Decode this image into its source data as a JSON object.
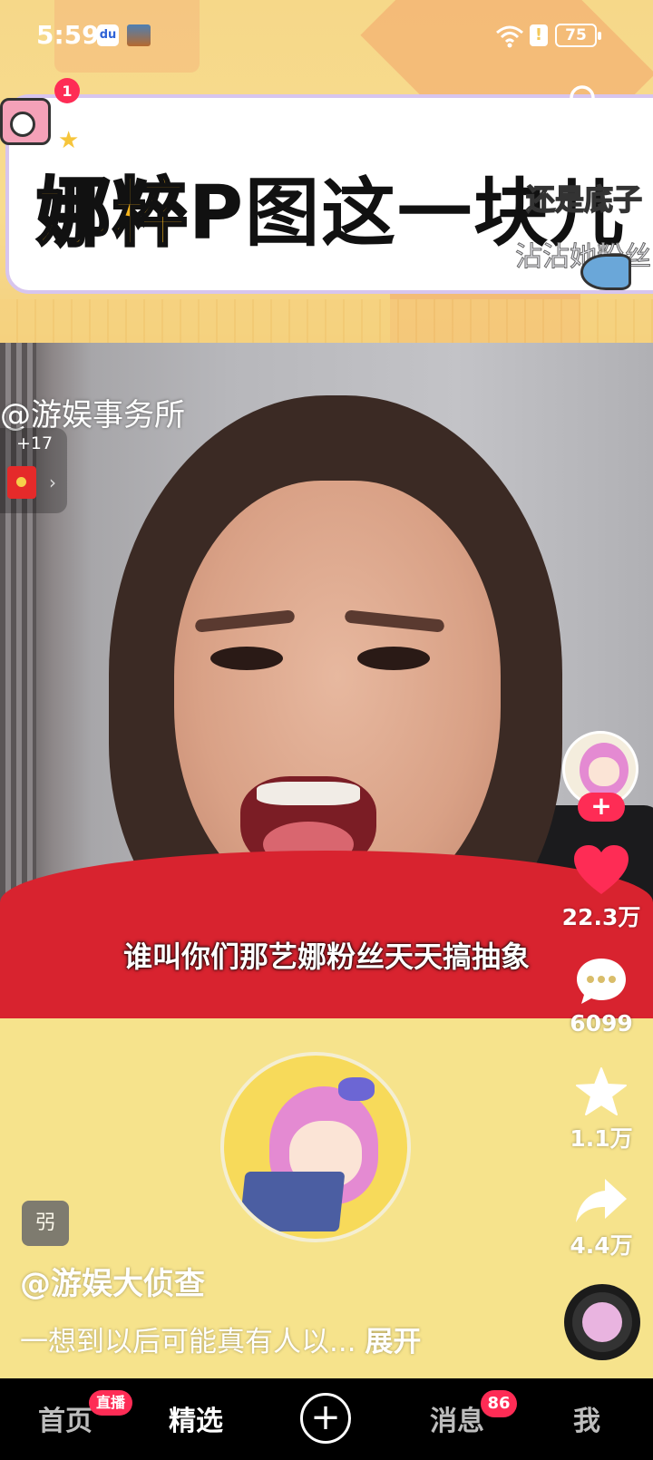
{
  "status_bar": {
    "time": "5:59",
    "battery": "75"
  },
  "banner": {
    "notification_count": "1",
    "headline_accent": "娜粹",
    "headline_main": "P图这一块儿",
    "side_text_1": "还是底子",
    "side_text_2": "沾沾她粉丝"
  },
  "video": {
    "watermark": "@游娱事务所",
    "subtitle": "谁叫你们那艺娜粉丝天天搞抽象",
    "red_packet_count": "+17"
  },
  "actions": {
    "likes": "22.3万",
    "comments": "6099",
    "favorites": "1.1万",
    "shares": "4.4万"
  },
  "post": {
    "ai_badge": "弜",
    "author": "@游娱大侦查",
    "description": "一想到以后可能真有人以...",
    "expand": "展开"
  },
  "nav": {
    "home": "首页",
    "live": "直播",
    "featured": "精选",
    "post": "+",
    "messages": "消息",
    "messages_count": "86",
    "me": "我"
  },
  "colors": {
    "accent": "#fe2c55",
    "banner_bg": "#f6d889",
    "lower_bg": "#f6e38c"
  }
}
